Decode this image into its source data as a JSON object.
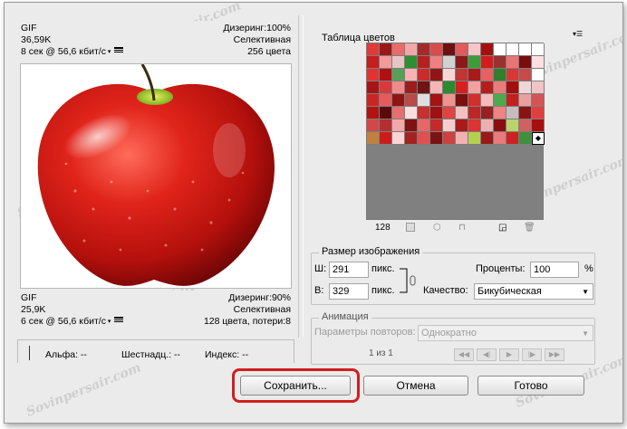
{
  "preview_top": {
    "format": "GIF",
    "size": "36,59K",
    "time": "8 сек @ 56,6 кбит/с",
    "dither": "Дизеринг:100%",
    "palette": "Селективная",
    "colors": "256 цвета"
  },
  "preview_bottom": {
    "format": "GIF",
    "size": "25,9K",
    "time": "6 сек @ 56,6 кбит/с",
    "dither": "Дизеринг:90%",
    "palette": "Селективная",
    "colors": "128 цвета, потери:8"
  },
  "status_bar": {
    "alpha": "Альфа: --",
    "hex": "Шестнадц.: --",
    "index": "Индекс: --"
  },
  "color_table": {
    "title": "Таблица цветов",
    "count": "128",
    "swatches": [
      "#e03a3a",
      "#9c1717",
      "#e96b6b",
      "#f4a7a7",
      "#a52a2a",
      "#d94c4c",
      "#6e1010",
      "#e45959",
      "#f7c7c7",
      "#a50f0f",
      "#ffffff",
      "#ffffff",
      "#ffffff",
      "#ffffff",
      "#c41e1e",
      "#f39a9a",
      "#e5c5c5",
      "#2f8e2f",
      "#b52020",
      "#f08080",
      "#d2d2d2",
      "#8a1a1a",
      "#3c9c3c",
      "#d41b1b",
      "#9b3030",
      "#e87575",
      "#7a0d0d",
      "#ffe0e0",
      "#e23333",
      "#b11010",
      "#58a058",
      "#f5b3b3",
      "#cc2b2b",
      "#901616",
      "#f9d5d5",
      "#c03535",
      "#a71a1a",
      "#e86060",
      "#2f7f2f",
      "#d73737",
      "#c94a4a",
      "#ffffff",
      "#a61515",
      "#d9383d",
      "#f18b8b",
      "#9c1d1d",
      "#6e1414",
      "#f9b5b5",
      "#2c8a2c",
      "#d71f1f",
      "#f2a1a1",
      "#b51d1d",
      "#eb7b7b",
      "#a20e0e",
      "#edd7d7",
      "#f0c4c4",
      "#cb2424",
      "#e45b5b",
      "#8f1515",
      "#b84b4b",
      "#dedede",
      "#a31414",
      "#ef9292",
      "#7b0f0f",
      "#d22e2e",
      "#f6baba",
      "#4caa4c",
      "#c02020",
      "#eaa0a0",
      "#d45454",
      "#b31212",
      "#5a0a0a",
      "#e56e6e",
      "#f9dede",
      "#c82f2f",
      "#9f1010",
      "#e14242",
      "#f2c0c0",
      "#bd2626",
      "#982020",
      "#ed8383",
      "#c7bcbc",
      "#8c1313",
      "#e03f3f",
      "#d04848",
      "#b52f2f",
      "#f2a8a8",
      "#7e1212",
      "#e76767",
      "#c32a2a",
      "#f6cdcd",
      "#aa1a1a",
      "#dc3333",
      "#ecb0b0",
      "#8a0e0e",
      "#b8d46a",
      "#d26060",
      "#a90f0f",
      "#c08040",
      "#cc1b1b",
      "#fad5d5",
      "#a42222",
      "#e15050",
      "#7a1414",
      "#cf4040",
      "#f3b0b0",
      "#b4d050",
      "#9a1818",
      "#e77a7a",
      "#cc2222",
      "#3e8f3e",
      "#ffffff"
    ]
  },
  "image_size": {
    "title": "Размер изображения",
    "width_label": "Ш:",
    "width_value": "291",
    "width_unit": "пикс.",
    "height_label": "В:",
    "height_value": "329",
    "height_unit": "пикс.",
    "percent_label": "Проценты:",
    "percent_value": "100",
    "percent_unit": "%",
    "quality_label": "Качество:",
    "quality_value": "Бикубическая"
  },
  "animation": {
    "title": "Анимация",
    "repeat_label": "Параметры повторов:",
    "repeat_value": "Однократно",
    "frame_counter": "1 из 1"
  },
  "buttons": {
    "save": "Сохранить...",
    "cancel": "Отмена",
    "done": "Готово"
  },
  "watermark": "Sovinpersair.com"
}
